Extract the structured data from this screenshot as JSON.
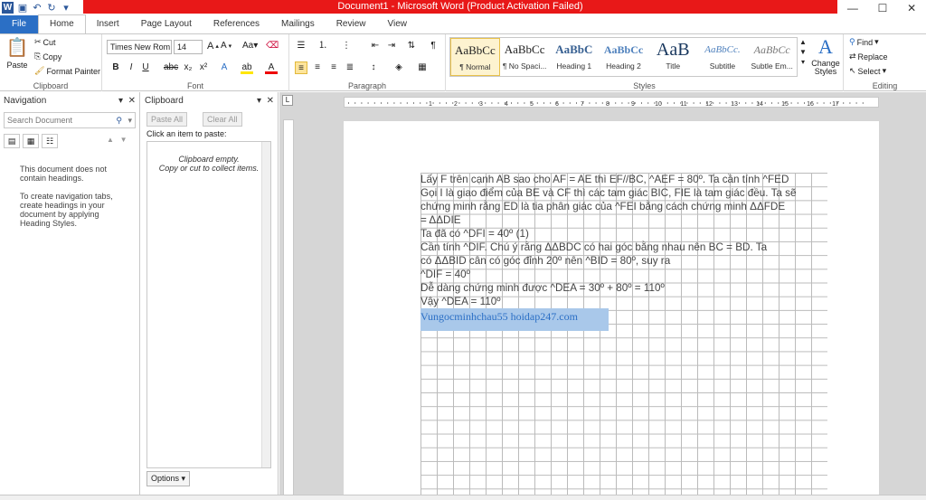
{
  "window": {
    "title": "Document1 - Microsoft Word (Product Activation Failed)"
  },
  "tabs": [
    "File",
    "Home",
    "Insert",
    "Page Layout",
    "References",
    "Mailings",
    "Review",
    "View"
  ],
  "clipboard_group": {
    "paste": "Paste",
    "cut": "Cut",
    "copy": "Copy",
    "format_painter": "Format Painter",
    "label": "Clipboard"
  },
  "font_group": {
    "font_name": "Times New Rom",
    "font_size": "14",
    "label": "Font"
  },
  "paragraph_group": {
    "label": "Paragraph"
  },
  "styles_group": {
    "label": "Styles",
    "items": [
      {
        "sample": "AaBbCc",
        "name": "¶ Normal"
      },
      {
        "sample": "AaBbCc",
        "name": "¶ No Spaci..."
      },
      {
        "sample": "AaBbC",
        "name": "Heading 1"
      },
      {
        "sample": "AaBbCc",
        "name": "Heading 2"
      },
      {
        "sample": "AaB",
        "name": "Title"
      },
      {
        "sample": "AaBbCc.",
        "name": "Subtitle"
      },
      {
        "sample": "AaBbCc",
        "name": "Subtle Em..."
      }
    ],
    "change_styles": "Change Styles"
  },
  "editing_group": {
    "find": "Find",
    "replace": "Replace",
    "select": "Select",
    "label": "Editing"
  },
  "navigation": {
    "title": "Navigation",
    "search_placeholder": "Search Document",
    "msg1": "This document does not contain headings.",
    "msg2": "To create navigation tabs, create headings in your document by applying Heading Styles."
  },
  "clipboard_pane": {
    "title": "Clipboard",
    "paste_all": "Paste All",
    "clear_all": "Clear All",
    "prompt": "Click an item to paste:",
    "empty1": "Clipboard empty.",
    "empty2": "Copy or cut to collect items.",
    "options": "Options"
  },
  "document": {
    "lines": [
      "Lấy F trên cạnh AB sao cho AF = AE thì EF//BC, ^AEF = 80º. Ta cần tính ^FED",
      "Gọi I là giao điểm của BE và CF thì các tam giác BIC, FIE là tam giác đều. Ta sẽ",
      "chứng minh rằng ED là tia phân giác của ^FEI bằng cách chứng minh ΔΔFDE",
      "= ΔΔDIE",
      "Ta đã có ^DFI = 40º (1)",
      "Cần tính ^DIF. Chú ý rằng ΔΔBDC có hai góc bằng nhau nên BC = BD. Ta",
      "có ΔΔBID cân có góc đỉnh 20º nên ^BID = 80º, suy ra",
      "^DIF = 40º",
      "Dễ dàng chứng minh được ^DEA = 30º + 80º = 110º",
      "Vậy ^DEA = 110º"
    ],
    "highlight": "Vungocminhchau55  hoidap247.com"
  },
  "ruler": {
    "h_numbers": [
      "1",
      "2",
      "3",
      "4",
      "5",
      "6",
      "7",
      "8",
      "9",
      "10",
      "11",
      "12",
      "13",
      "14",
      "15",
      "16",
      "17"
    ]
  },
  "colors": {
    "accent": "#2b579a",
    "title_bar": "#e81818",
    "file_tab": "#2b6fc5",
    "highlight": "#a9c8ea"
  }
}
